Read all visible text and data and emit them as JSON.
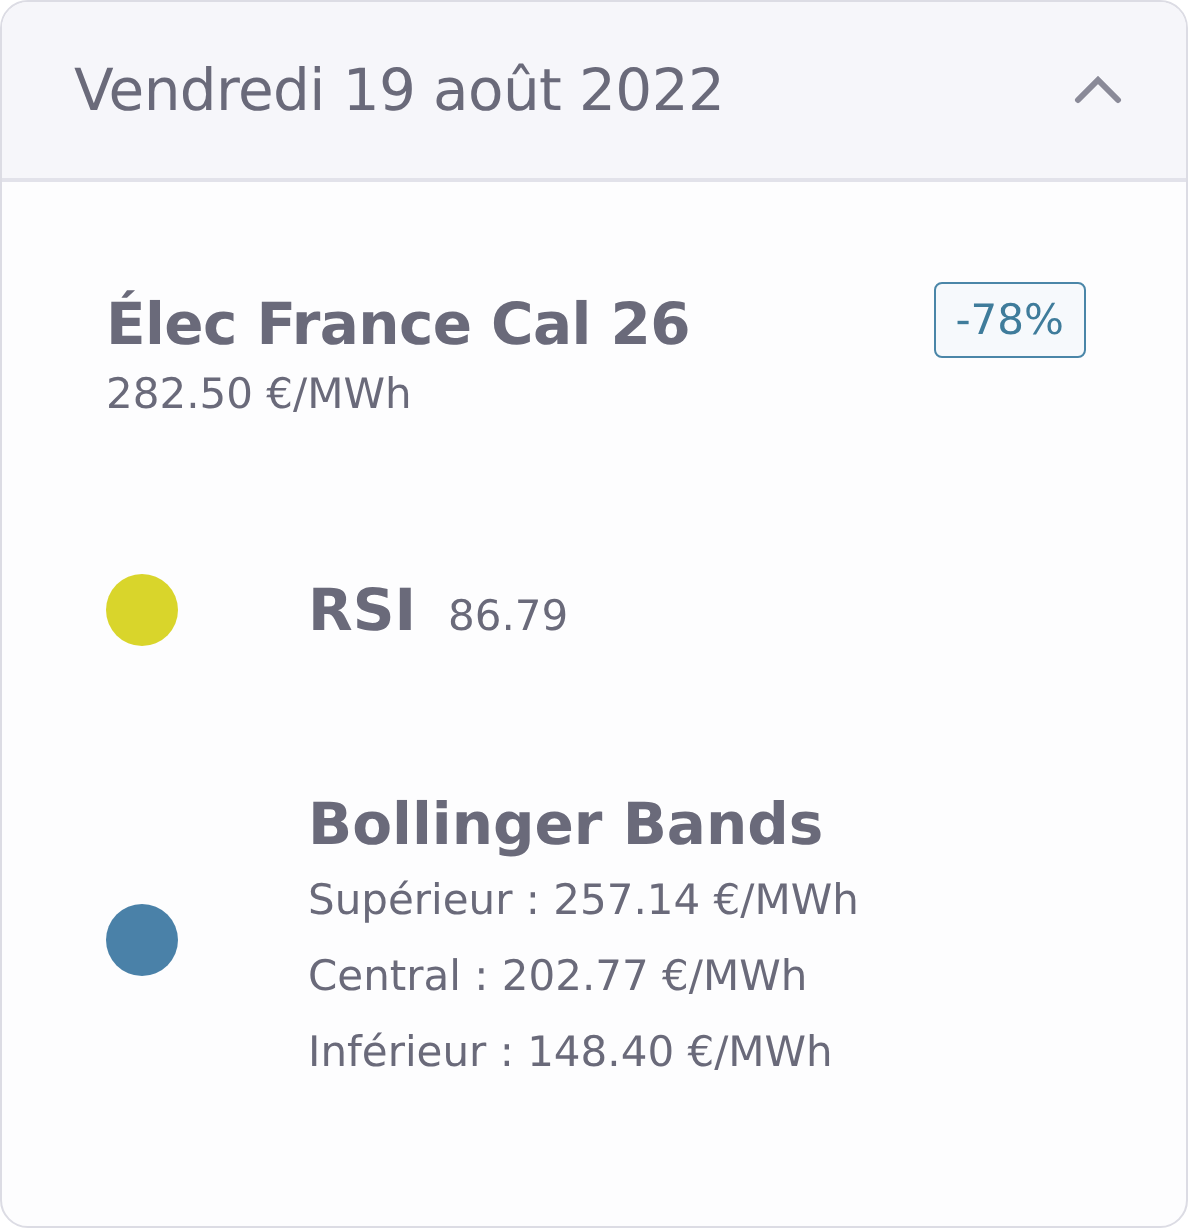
{
  "header": {
    "title": "Vendredi 19 août 2022",
    "expanded": true
  },
  "instrument": {
    "name": "Élec France Cal 26",
    "price": "282.50 €/MWh",
    "change": "-78%"
  },
  "indicators": [
    {
      "kind": "single",
      "name": "RSI",
      "value": "86.79",
      "color": "#d9d52b"
    },
    {
      "kind": "bands",
      "name": "Bollinger Bands",
      "lines": [
        "Supérieur : 257.14 €/MWh",
        "Central : 202.77 €/MWh",
        "Inférieur : 148.40 €/MWh"
      ],
      "color": "#4a81a8"
    }
  ]
}
